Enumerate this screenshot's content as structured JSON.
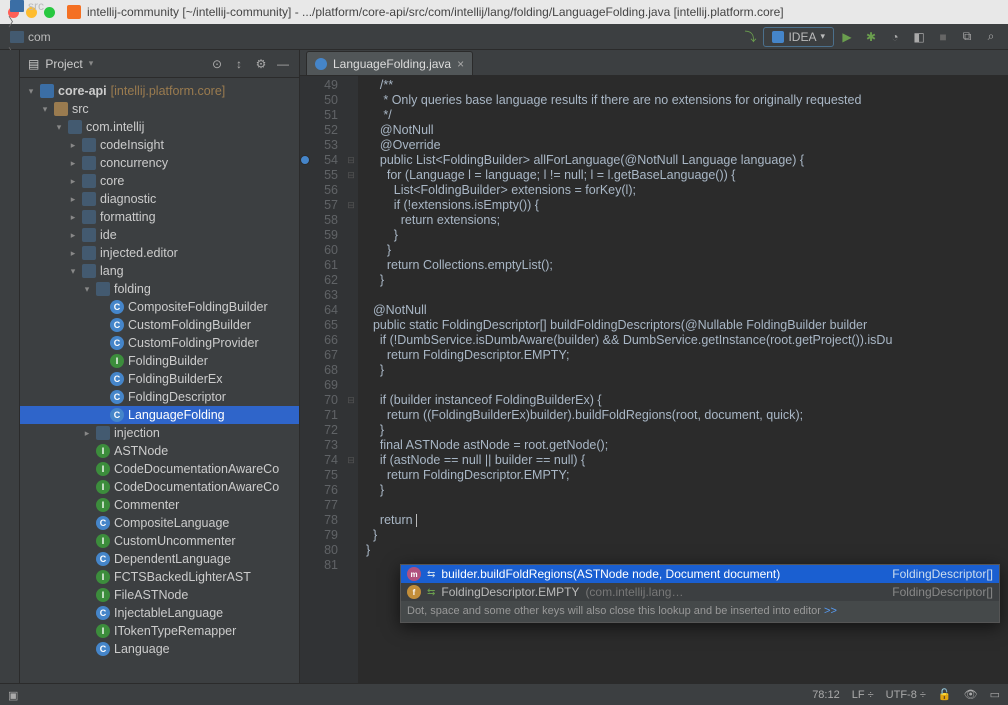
{
  "title": "intellij-community [~/intellij-community] - .../platform/core-api/src/com/intellij/lang/folding/LanguageFolding.java [intellij.platform.core]",
  "breadcrumb": [
    "intellij-community",
    "platform",
    "core-api",
    "src",
    "com",
    "intellij",
    "lang",
    "folding",
    "LanguageFolding"
  ],
  "run_config": "IDEA",
  "side_title": "Project",
  "tree": [
    {
      "d": 0,
      "a": "open",
      "t": "mod",
      "l": "core-api",
      "suf": "[intellij.platform.core]",
      "b": true
    },
    {
      "d": 1,
      "a": "open",
      "t": "folder",
      "l": "src"
    },
    {
      "d": 2,
      "a": "open",
      "t": "pkg",
      "l": "com.intellij"
    },
    {
      "d": 3,
      "a": "closed",
      "t": "pkg",
      "l": "codeInsight"
    },
    {
      "d": 3,
      "a": "closed",
      "t": "pkg",
      "l": "concurrency"
    },
    {
      "d": 3,
      "a": "closed",
      "t": "pkg",
      "l": "core"
    },
    {
      "d": 3,
      "a": "closed",
      "t": "pkg",
      "l": "diagnostic"
    },
    {
      "d": 3,
      "a": "closed",
      "t": "pkg",
      "l": "formatting"
    },
    {
      "d": 3,
      "a": "closed",
      "t": "pkg",
      "l": "ide"
    },
    {
      "d": 3,
      "a": "closed",
      "t": "pkg",
      "l": "injected.editor"
    },
    {
      "d": 3,
      "a": "open",
      "t": "pkg",
      "l": "lang"
    },
    {
      "d": 4,
      "a": "open",
      "t": "pkg",
      "l": "folding"
    },
    {
      "d": 5,
      "a": "none",
      "t": "cls",
      "l": "CompositeFoldingBuilder"
    },
    {
      "d": 5,
      "a": "none",
      "t": "cls",
      "l": "CustomFoldingBuilder"
    },
    {
      "d": 5,
      "a": "none",
      "t": "cls",
      "l": "CustomFoldingProvider"
    },
    {
      "d": 5,
      "a": "none",
      "t": "intf",
      "l": "FoldingBuilder"
    },
    {
      "d": 5,
      "a": "none",
      "t": "cls",
      "l": "FoldingBuilderEx"
    },
    {
      "d": 5,
      "a": "none",
      "t": "cls",
      "l": "FoldingDescriptor"
    },
    {
      "d": 5,
      "a": "none",
      "t": "cls",
      "l": "LanguageFolding",
      "sel": true
    },
    {
      "d": 4,
      "a": "closed",
      "t": "pkg",
      "l": "injection"
    },
    {
      "d": 4,
      "a": "none",
      "t": "intf",
      "l": "ASTNode"
    },
    {
      "d": 4,
      "a": "none",
      "t": "intf",
      "l": "CodeDocumentationAwareCo"
    },
    {
      "d": 4,
      "a": "none",
      "t": "intf",
      "l": "CodeDocumentationAwareCo"
    },
    {
      "d": 4,
      "a": "none",
      "t": "intf",
      "l": "Commenter"
    },
    {
      "d": 4,
      "a": "none",
      "t": "cls",
      "l": "CompositeLanguage"
    },
    {
      "d": 4,
      "a": "none",
      "t": "intf",
      "l": "CustomUncommenter"
    },
    {
      "d": 4,
      "a": "none",
      "t": "cls",
      "l": "DependentLanguage"
    },
    {
      "d": 4,
      "a": "none",
      "t": "intf",
      "l": "FCTSBackedLighterAST"
    },
    {
      "d": 4,
      "a": "none",
      "t": "intf",
      "l": "FileASTNode"
    },
    {
      "d": 4,
      "a": "none",
      "t": "cls",
      "l": "InjectableLanguage"
    },
    {
      "d": 4,
      "a": "none",
      "t": "intf",
      "l": "ITokenTypeRemapper"
    },
    {
      "d": 4,
      "a": "none",
      "t": "cls",
      "l": "Language"
    }
  ],
  "tab": "LanguageFolding.java",
  "line_start": 49,
  "override_line": 54,
  "code": [
    "    <cmt>/**</cmt>",
    "<cmt>     * Only queries base language results if there are no extensions for originally requested</cmt>",
    "<cmt>     */</cmt>",
    "    <ann>@NotNull</ann>",
    "    <ann>@Override</ann>",
    "    <kw>public</kw> List&lt;FoldingBuilder&gt; <fn>allForLanguage</fn>(<ann>@NotNull</ann> Language <par>language</par>) {",
    "      <kw>for</kw> (Language <par>l</par> = <par>language</par>; <par>l</par> != <kw>null</kw>; <par>l</par> = <par>l</par>.getBaseLanguage()) {",
    "        List&lt;FoldingBuilder&gt; <par>extensions</par> = forKey(<par>l</par>);",
    "        <kw>if</kw> (!<par>extensions</par>.isEmpty()) {",
    "          <kw>return</kw> <par>extensions</par>;",
    "        }",
    "      }",
    "      <kw>return</kw> Collections.<fld>emptyList</fld>();",
    "    }",
    "",
    "  <ann>@NotNull</ann>",
    "  <kw>public static</kw> FoldingDescriptor[] <fn>buildFoldingDescriptors</fn>(<ann>@Nullable</ann> FoldingBuilder <par>builder</par>",
    "    <kw>if</kw> (!DumbService.<fld>isDumbAware</fld>(<par>builder</par>) &amp;&amp; DumbService.<fld>getInstance</fld>(<par>root</par>.getProject()).isDu",
    "      <kw>return</kw> FoldingDescriptor.<fld>EMPTY</fld>;",
    "    }",
    "",
    "    <kw>if</kw> (<par>builder</par> <kw>instanceof</kw> FoldingBuilderEx) {",
    "      <kw>return</kw> ((FoldingBuilderEx)<par>builder</par>).buildFoldRegions(<par>root</par>, <par>document</par>, <par>quick</par>);",
    "    }",
    "    <kw>final</kw> ASTNode <par>astNode</par> = <par>root</par>.getNode();",
    "    <kw>if</kw> (<par>astNode</par> == <kw>null</kw> || <par>builder</par> == <kw>null</kw>) {",
    "      <kw>return</kw> FoldingDescriptor.<fld>EMPTY</fld>;",
    "    }",
    "",
    "    <kw>return</kw> <span class=\"caret\"></span>",
    "  }",
    "}",
    ""
  ],
  "popup": {
    "items": [
      {
        "k": "m",
        "label": "builder.buildFoldRegions(ASTNode node, Document document)",
        "ret": "FoldingDescriptor[]",
        "sel": true
      },
      {
        "k": "f",
        "label": "FoldingDescriptor.EMPTY",
        "pkg": "(com.intellij.lang…",
        "ret": "FoldingDescriptor[]"
      }
    ],
    "hint": "Dot, space and some other keys will also close this lookup and be inserted into editor",
    "hint_link": ">>"
  },
  "status": {
    "pos": "78:12",
    "eol": "LF",
    "enc": "UTF-8"
  }
}
